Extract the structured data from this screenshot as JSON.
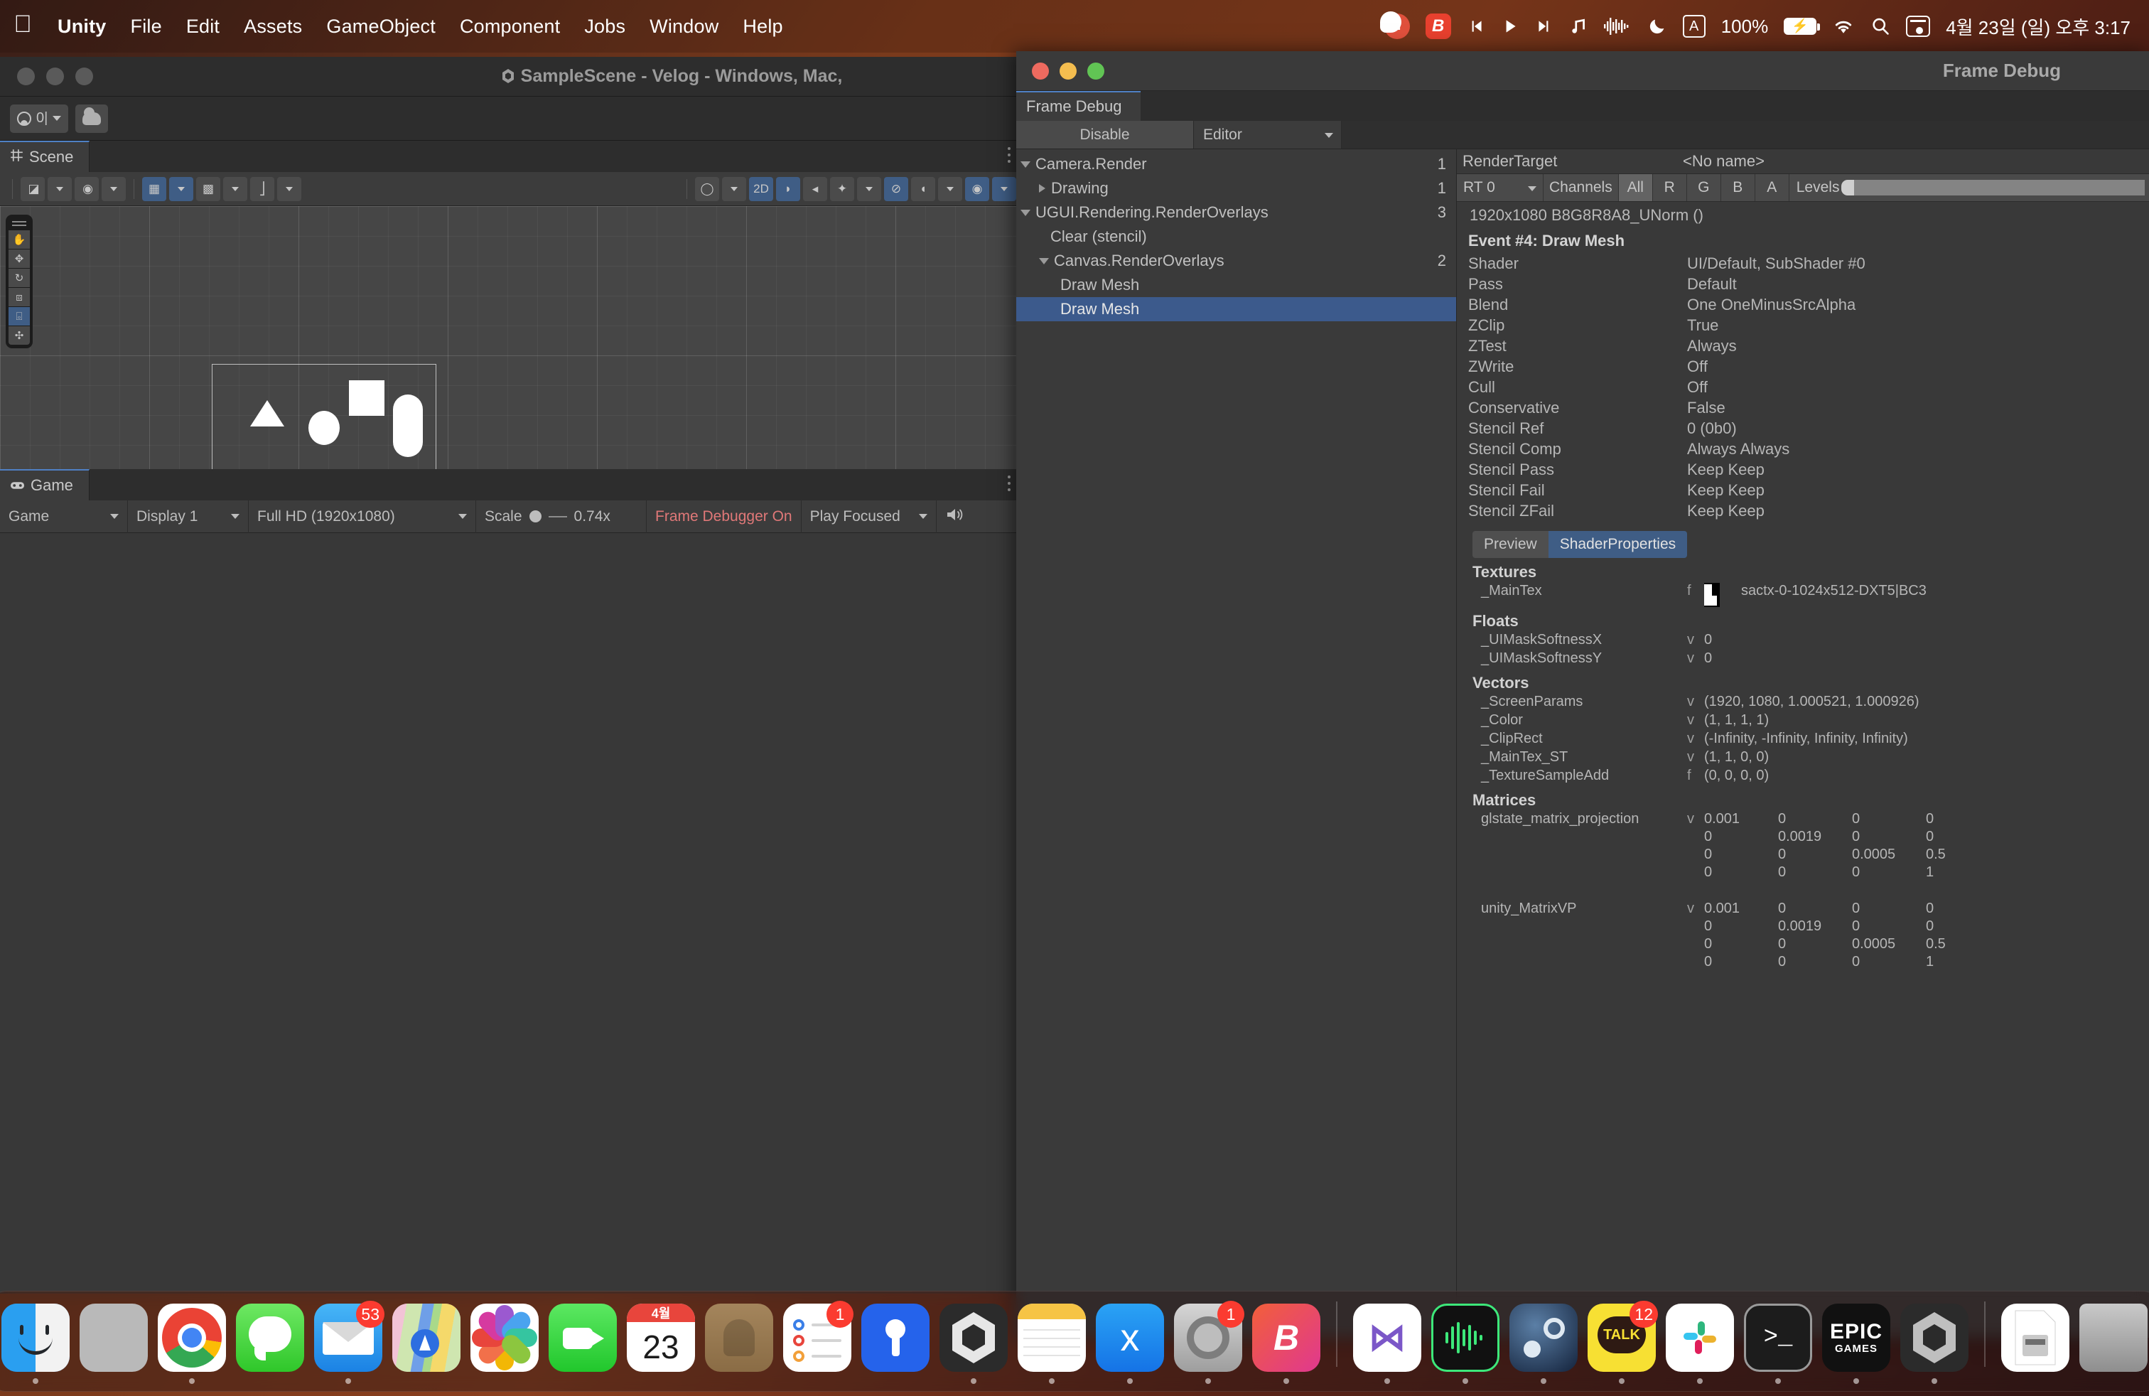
{
  "menubar": {
    "apple_icon": "apple-logo-icon",
    "items": [
      {
        "label": "Unity",
        "bold": true
      },
      {
        "label": "File",
        "bold": false
      },
      {
        "label": "Edit",
        "bold": false
      },
      {
        "label": "Assets",
        "bold": false
      },
      {
        "label": "GameObject",
        "bold": false
      },
      {
        "label": "Component",
        "bold": false
      },
      {
        "label": "Jobs",
        "bold": false
      },
      {
        "label": "Window",
        "bold": false
      },
      {
        "label": "Help",
        "bold": false
      }
    ],
    "status": {
      "battery_percent": "100%",
      "clock": "4월 23일 (일) 오후 3:17",
      "input_source": "A"
    }
  },
  "unity_window": {
    "title": "SampleScene - Velog - Windows, Mac,",
    "toolbar": {
      "account_label": "0|",
      "cloud_icon": "cloud-icon"
    },
    "scene_panel": {
      "tab_label": "Scene",
      "toolbar_buttons": [
        {
          "name": "draw-mode-dropdown",
          "glyph": "◪",
          "active": false,
          "dropdown": true
        },
        {
          "name": "shading-mode-dropdown",
          "glyph": "◍",
          "active": false,
          "dropdown": true
        },
        {
          "name": "2d-grid-toggle",
          "glyph": "▦",
          "active": true,
          "dropdown": true
        },
        {
          "name": "snap-toggle",
          "glyph": "▥",
          "active": false,
          "dropdown": true
        },
        {
          "name": "grid-size-slider",
          "glyph": "⦀",
          "active": false,
          "dropdown": true
        },
        {
          "name": "gizmo-visibility",
          "glyph": "◯",
          "active": false,
          "dropdown": true
        },
        {
          "name": "2d-toggle",
          "glyph": "2D",
          "active": true,
          "dropdown": false
        },
        {
          "name": "lighting-toggle",
          "glyph": "◗",
          "active": true,
          "dropdown": false
        },
        {
          "name": "audio-toggle",
          "glyph": "⊲",
          "active": false,
          "dropdown": false
        },
        {
          "name": "fx-dropdown",
          "glyph": "✦",
          "active": false,
          "dropdown": true
        },
        {
          "name": "hidden-objects-toggle",
          "glyph": "⊘",
          "active": true,
          "dropdown": false
        },
        {
          "name": "camera-settings",
          "glyph": "◐",
          "active": false,
          "dropdown": true
        },
        {
          "name": "scene-gizmo-toggle",
          "glyph": "◉",
          "active": true,
          "dropdown": true
        }
      ],
      "left_tools": [
        {
          "name": "hand-tool",
          "glyph": "✋",
          "active": false
        },
        {
          "name": "move-tool",
          "glyph": "✥",
          "active": false
        },
        {
          "name": "rotate-tool",
          "glyph": "↻",
          "active": false
        },
        {
          "name": "scale-tool",
          "glyph": "⬈",
          "active": false
        },
        {
          "name": "rect-tool",
          "glyph": "⬚",
          "active": true
        },
        {
          "name": "transform-tool",
          "glyph": "✜",
          "active": false
        }
      ]
    },
    "game_panel": {
      "tab_label": "Game",
      "view_mode": "Game",
      "display": "Display 1",
      "resolution": "Full HD (1920x1080)",
      "scale_label": "Scale",
      "scale_value": "0.74x",
      "frame_debugger": "Frame Debugger On",
      "play_mode": "Play Focused",
      "background_color": "#414f7a"
    }
  },
  "frame_debug": {
    "window_title": "Frame Debug",
    "tab_label": "Frame Debug",
    "toolbar": {
      "disable_label": "Disable",
      "target_label": "Editor"
    },
    "tree": [
      {
        "label": "Camera.Render",
        "count": "1",
        "depth": 0,
        "expand": "down",
        "selected": false
      },
      {
        "label": "Drawing",
        "count": "1",
        "depth": 1,
        "expand": "right",
        "selected": false
      },
      {
        "label": "UGUI.Rendering.RenderOverlays",
        "count": "3",
        "depth": 0,
        "expand": "down",
        "selected": false
      },
      {
        "label": "Clear (stencil)",
        "count": "",
        "depth": 1,
        "expand": "none",
        "selected": false
      },
      {
        "label": "Canvas.RenderOverlays",
        "count": "2",
        "depth": 1,
        "expand": "down",
        "selected": false
      },
      {
        "label": "Draw Mesh",
        "count": "",
        "depth": 2,
        "expand": "none",
        "selected": false
      },
      {
        "label": "Draw Mesh",
        "count": "",
        "depth": 2,
        "expand": "none",
        "selected": true
      }
    ],
    "render_target": {
      "label": "RenderTarget",
      "name": "<No name>",
      "rt_select": "RT 0",
      "channels_label": "Channels",
      "channels": [
        "All",
        "R",
        "G",
        "B",
        "A"
      ],
      "channel_active": "All",
      "levels_label": "Levels",
      "info": "1920x1080 B8G8R8A8_UNorm ()"
    },
    "event_title": "Event #4: Draw Mesh",
    "properties": [
      {
        "key": "Shader",
        "value": "UI/Default, SubShader #0"
      },
      {
        "key": "Pass",
        "value": "Default"
      },
      {
        "key": "Blend",
        "value": "One OneMinusSrcAlpha"
      },
      {
        "key": "ZClip",
        "value": "True"
      },
      {
        "key": "ZTest",
        "value": "Always"
      },
      {
        "key": "ZWrite",
        "value": "Off"
      },
      {
        "key": "Cull",
        "value": "Off"
      },
      {
        "key": "Conservative",
        "value": "False"
      },
      {
        "key": "Stencil Ref",
        "value": "0 (0b0)"
      },
      {
        "key": "Stencil Comp",
        "value": "Always Always"
      },
      {
        "key": "Stencil Pass",
        "value": "Keep Keep"
      },
      {
        "key": "Stencil Fail",
        "value": "Keep Keep"
      },
      {
        "key": "Stencil ZFail",
        "value": "Keep Keep"
      }
    ],
    "sub_tabs": [
      {
        "label": "Preview",
        "active": false
      },
      {
        "label": "ShaderProperties",
        "active": true
      }
    ],
    "shader_properties": {
      "textures_header": "Textures",
      "textures": [
        {
          "name": "_MainTex",
          "flag": "f",
          "value": "sactx-0-1024x512-DXT5|BC3"
        }
      ],
      "floats_header": "Floats",
      "floats": [
        {
          "name": "_UIMaskSoftnessX",
          "flag": "v",
          "value": "0"
        },
        {
          "name": "_UIMaskSoftnessY",
          "flag": "v",
          "value": "0"
        }
      ],
      "vectors_header": "Vectors",
      "vectors": [
        {
          "name": "_ScreenParams",
          "flag": "v",
          "value": "(1920, 1080, 1.000521, 1.000926)"
        },
        {
          "name": "_Color",
          "flag": "v",
          "value": "(1, 1, 1, 1)"
        },
        {
          "name": "_ClipRect",
          "flag": "v",
          "value": "(-Infinity, -Infinity, Infinity, Infinity)"
        },
        {
          "name": "_MainTex_ST",
          "flag": "v",
          "value": "(1, 1, 0, 0)"
        },
        {
          "name": "_TextureSampleAdd",
          "flag": "f",
          "value": "(0, 0, 0, 0)"
        }
      ],
      "matrices_header": "Matrices",
      "matrices": [
        {
          "name": "glstate_matrix_projection",
          "flag": "v",
          "rows": [
            [
              "0.001",
              "0",
              "0",
              "0"
            ],
            [
              "0",
              "0.0019",
              "0",
              "0"
            ],
            [
              "0",
              "0",
              "0.0005",
              "0.5"
            ],
            [
              "0",
              "0",
              "0",
              "1"
            ]
          ]
        },
        {
          "name": "unity_MatrixVP",
          "flag": "v",
          "rows": [
            [
              "0.001",
              "0",
              "0",
              "0"
            ],
            [
              "0",
              "0.0019",
              "0",
              "0"
            ],
            [
              "0",
              "0",
              "0.0005",
              "0.5"
            ],
            [
              "0",
              "0",
              "0",
              "1"
            ]
          ]
        }
      ]
    }
  },
  "dock": {
    "items": [
      {
        "name": "finder",
        "label": "Finder",
        "badge": "",
        "running": true
      },
      {
        "name": "launchpad",
        "label": "Launchpad",
        "badge": "",
        "running": false
      },
      {
        "name": "chrome",
        "label": "Google Chrome",
        "badge": "",
        "running": true
      },
      {
        "name": "messages",
        "label": "Messages",
        "badge": "",
        "running": false
      },
      {
        "name": "mail",
        "label": "Mail",
        "badge": "53",
        "running": true
      },
      {
        "name": "maps",
        "label": "Maps",
        "badge": "",
        "running": false
      },
      {
        "name": "photos",
        "label": "Photos",
        "badge": "",
        "running": false
      },
      {
        "name": "facetime",
        "label": "FaceTime",
        "badge": "",
        "running": false
      },
      {
        "name": "calendar",
        "label": "Calendar",
        "badge": "",
        "running": false,
        "month": "4월",
        "day": "23"
      },
      {
        "name": "wallet",
        "label": "Wallet",
        "badge": "",
        "running": false
      },
      {
        "name": "reminders",
        "label": "Reminders",
        "badge": "1",
        "running": false
      },
      {
        "name": "podcasts",
        "label": "Podcasts",
        "badge": "",
        "running": false
      },
      {
        "name": "unity-hub",
        "label": "Unity Hub",
        "badge": "",
        "running": true
      },
      {
        "name": "notes",
        "label": "Notes",
        "badge": "",
        "running": true
      },
      {
        "name": "app-store",
        "label": "App Store",
        "badge": "",
        "running": true
      },
      {
        "name": "system-preferences",
        "label": "System Preferences",
        "badge": "1",
        "running": true
      },
      {
        "name": "bz",
        "label": "Bz",
        "badge": "",
        "running": true
      },
      {
        "name": "visual-studio",
        "label": "Visual Studio",
        "badge": "",
        "running": true
      },
      {
        "name": "audio-app",
        "label": "Audio",
        "badge": "",
        "running": true
      },
      {
        "name": "steam",
        "label": "Steam",
        "badge": "",
        "running": true
      },
      {
        "name": "kakaotalk",
        "label": "KakaoTalk",
        "badge": "12",
        "running": true
      },
      {
        "name": "slack",
        "label": "Slack",
        "badge": "",
        "running": true
      },
      {
        "name": "terminal",
        "label": "Terminal",
        "badge": "",
        "running": true
      },
      {
        "name": "epic-games",
        "label": "Epic Games",
        "badge": "",
        "running": true
      },
      {
        "name": "unity-editor",
        "label": "Unity",
        "badge": "",
        "running": true
      },
      {
        "name": "document",
        "label": "Document",
        "badge": "",
        "running": false
      },
      {
        "name": "trash",
        "label": "Trash",
        "badge": "",
        "running": false
      }
    ]
  }
}
